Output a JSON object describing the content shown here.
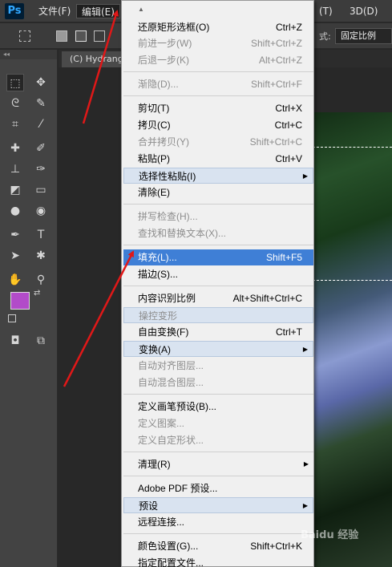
{
  "app": {
    "logo": "Ps"
  },
  "menubar": {
    "file": "文件(F)",
    "edit": "编辑(E)",
    "right_a": "(T)",
    "right_b": "3D(D)"
  },
  "options": {
    "style_label": "式:",
    "style_value": "固定比例"
  },
  "toolbox": {
    "header": "◂◂"
  },
  "document": {
    "tab_title": "(C) Hydrangea"
  },
  "edit_menu": {
    "items": [
      {
        "label": "还原矩形选框(O)",
        "shortcut": "Ctrl+Z",
        "state": "normal"
      },
      {
        "label": "前进一步(W)",
        "shortcut": "Shift+Ctrl+Z",
        "state": "disabled"
      },
      {
        "label": "后退一步(K)",
        "shortcut": "Alt+Ctrl+Z",
        "state": "disabled"
      },
      {
        "label": "渐隐(D)...",
        "shortcut": "Shift+Ctrl+F",
        "state": "disabled"
      },
      {
        "label": "剪切(T)",
        "shortcut": "Ctrl+X",
        "state": "normal"
      },
      {
        "label": "拷贝(C)",
        "shortcut": "Ctrl+C",
        "state": "normal"
      },
      {
        "label": "合并拷贝(Y)",
        "shortcut": "Shift+Ctrl+C",
        "state": "disabled"
      },
      {
        "label": "粘贴(P)",
        "shortcut": "Ctrl+V",
        "state": "normal"
      },
      {
        "label": "选择性粘贴(I)",
        "shortcut": "",
        "state": "submenu"
      },
      {
        "label": "清除(E)",
        "shortcut": "",
        "state": "normal"
      },
      {
        "label": "拼写检查(H)...",
        "shortcut": "",
        "state": "disabled"
      },
      {
        "label": "查找和替换文本(X)...",
        "shortcut": "",
        "state": "disabled"
      },
      {
        "label": "填充(L)...",
        "shortcut": "Shift+F5",
        "state": "selected"
      },
      {
        "label": "描边(S)...",
        "shortcut": "",
        "state": "normal"
      },
      {
        "label": "内容识别比例",
        "shortcut": "Alt+Shift+Ctrl+C",
        "state": "normal"
      },
      {
        "label": "操控变形",
        "shortcut": "",
        "state": "disabled-hl"
      },
      {
        "label": "自由变换(F)",
        "shortcut": "Ctrl+T",
        "state": "normal"
      },
      {
        "label": "变换(A)",
        "shortcut": "",
        "state": "submenu"
      },
      {
        "label": "自动对齐图层...",
        "shortcut": "",
        "state": "disabled"
      },
      {
        "label": "自动混合图层...",
        "shortcut": "",
        "state": "disabled"
      },
      {
        "label": "定义画笔预设(B)...",
        "shortcut": "",
        "state": "normal"
      },
      {
        "label": "定义图案...",
        "shortcut": "",
        "state": "disabled"
      },
      {
        "label": "定义自定形状...",
        "shortcut": "",
        "state": "disabled"
      },
      {
        "label": "清理(R)",
        "shortcut": "",
        "state": "submenu-plain"
      },
      {
        "label": "Adobe PDF 预设...",
        "shortcut": "",
        "state": "normal"
      },
      {
        "label": "预设",
        "shortcut": "",
        "state": "submenu"
      },
      {
        "label": "远程连接...",
        "shortcut": "",
        "state": "normal"
      },
      {
        "label": "颜色设置(G)...",
        "shortcut": "Shift+Ctrl+K",
        "state": "normal"
      },
      {
        "label": "指定配置文件...",
        "shortcut": "",
        "state": "normal"
      }
    ]
  },
  "watermark": "Baidu 经验"
}
